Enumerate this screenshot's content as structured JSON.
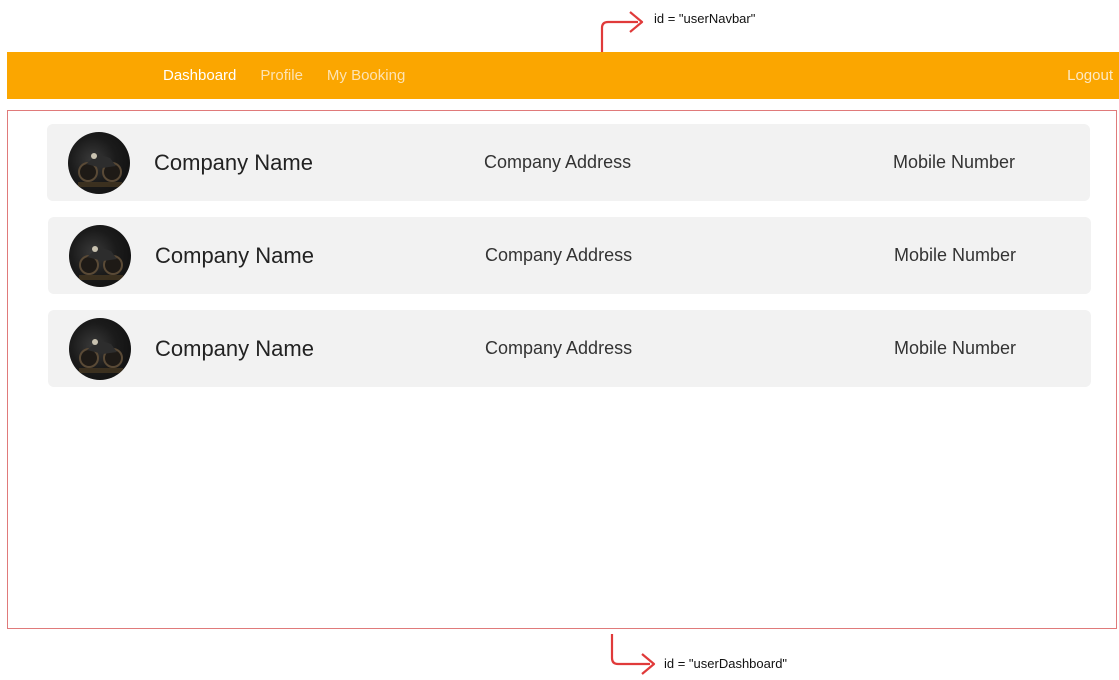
{
  "annotations": {
    "top_label": "id = \"userNavbar\"",
    "bottom_label": "id = \"userDashboard\"",
    "arrow_color": "#e03a3a"
  },
  "navbar": {
    "background": "#fba600",
    "links": [
      {
        "label": "Dashboard",
        "active": true
      },
      {
        "label": "Profile",
        "active": false
      },
      {
        "label": "My Booking",
        "active": false
      }
    ],
    "logout_label": "Logout"
  },
  "dashboard": {
    "cards": [
      {
        "company_name": "Company Name",
        "company_address": "Company Address",
        "mobile_number": "Mobile Number",
        "avatar_icon": "motorcycle-photo"
      },
      {
        "company_name": "Company Name",
        "company_address": "Company Address",
        "mobile_number": "Mobile Number",
        "avatar_icon": "motorcycle-photo"
      },
      {
        "company_name": "Company Name",
        "company_address": "Company Address",
        "mobile_number": "Mobile Number",
        "avatar_icon": "motorcycle-photo"
      }
    ]
  }
}
